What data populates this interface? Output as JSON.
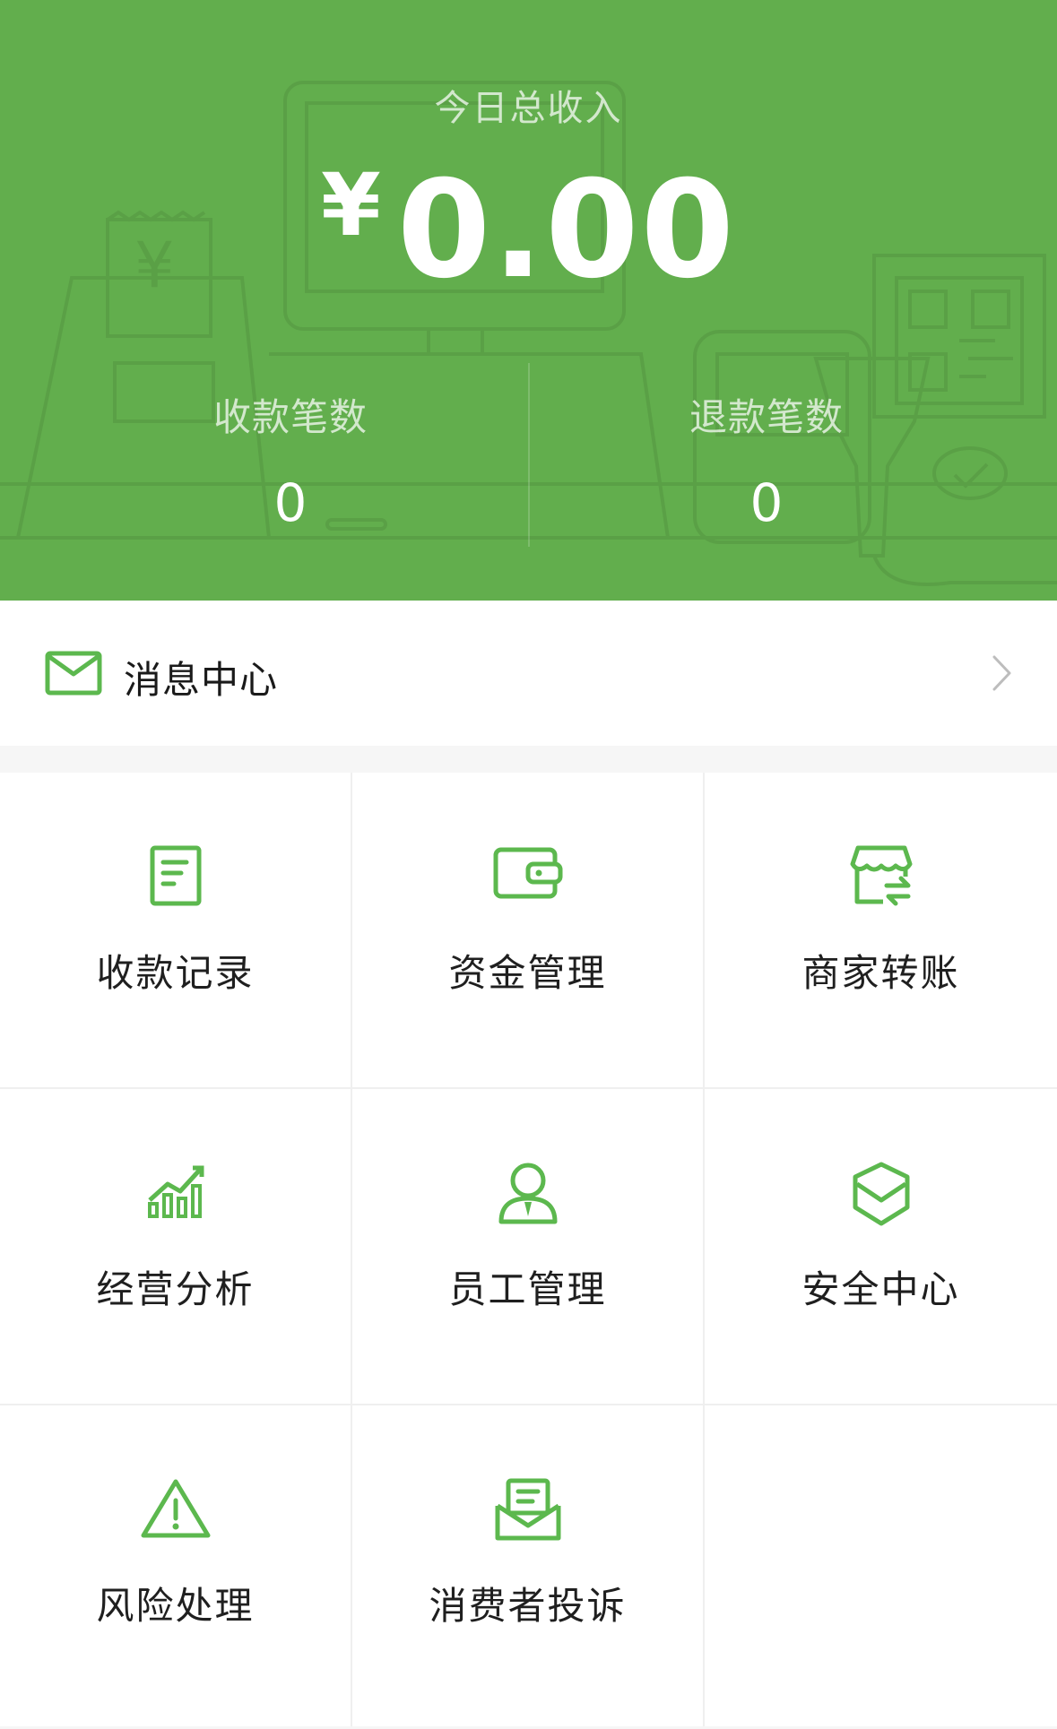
{
  "colors": {
    "header_green": "#62ae4d",
    "icon_green": "#5cb84e",
    "text_dark": "#1f1f1f",
    "page_bg": "#f6f6f6"
  },
  "header": {
    "title": "今日总收入",
    "currency": "¥",
    "amount": "0.00",
    "stats": [
      {
        "label": "收款笔数",
        "value": "0"
      },
      {
        "label": "退款笔数",
        "value": "0"
      }
    ]
  },
  "message_center": {
    "label": "消息中心",
    "icon": "envelope-icon"
  },
  "menu": [
    {
      "label": "收款记录",
      "icon": "receipt-list-icon"
    },
    {
      "label": "资金管理",
      "icon": "wallet-icon"
    },
    {
      "label": "商家转账",
      "icon": "store-transfer-icon"
    },
    {
      "label": "经营分析",
      "icon": "bar-chart-icon"
    },
    {
      "label": "员工管理",
      "icon": "staff-icon"
    },
    {
      "label": "安全中心",
      "icon": "shield-check-icon"
    },
    {
      "label": "风险处理",
      "icon": "warning-icon"
    },
    {
      "label": "消费者投诉",
      "icon": "complaint-mail-icon"
    }
  ]
}
